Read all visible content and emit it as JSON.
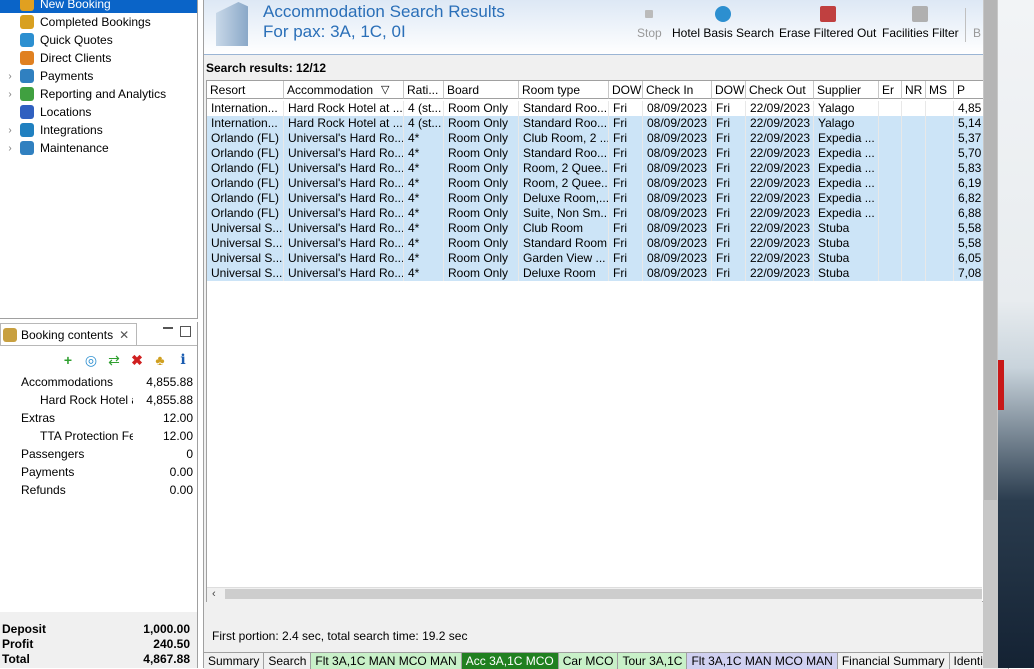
{
  "nav": {
    "items": [
      {
        "label": "New Booking",
        "selected": true,
        "expandable": false,
        "icon": "new-booking-icon",
        "color": "#e0a020"
      },
      {
        "label": "Completed Bookings",
        "selected": false,
        "expandable": false,
        "icon": "palm-icon",
        "color": "#d8a020"
      },
      {
        "label": "Quick Quotes",
        "selected": false,
        "expandable": false,
        "icon": "globe-icon",
        "color": "#2c8fd0"
      },
      {
        "label": "Direct Clients",
        "selected": false,
        "expandable": false,
        "icon": "user-icon",
        "color": "#e08020"
      },
      {
        "label": "Payments",
        "selected": false,
        "expandable": true,
        "icon": "payments-icon",
        "color": "#3080c0"
      },
      {
        "label": "Reporting and Analytics",
        "selected": false,
        "expandable": true,
        "icon": "analytics-icon",
        "color": "#40a040"
      },
      {
        "label": "Locations",
        "selected": false,
        "expandable": false,
        "icon": "locations-icon",
        "color": "#3060c0"
      },
      {
        "label": "Integrations",
        "selected": false,
        "expandable": true,
        "icon": "integrations-icon",
        "color": "#2080c0"
      },
      {
        "label": "Maintenance",
        "selected": false,
        "expandable": true,
        "icon": "maintenance-icon",
        "color": "#3080c0"
      }
    ]
  },
  "booking": {
    "tab_label": "Booking contents",
    "rows": [
      {
        "label": "Accommodations",
        "value": "4,855.88",
        "indent": 1
      },
      {
        "label": "Hard Rock Hotel at Universal",
        "value": "4,855.88",
        "indent": 2
      },
      {
        "label": "Extras",
        "value": "12.00",
        "indent": 1
      },
      {
        "label": "TTA Protection Fee",
        "value": "12.00",
        "indent": 2
      },
      {
        "label": "Passengers",
        "value": "0",
        "indent": 1
      },
      {
        "label": "Payments",
        "value": "0.00",
        "indent": 1
      },
      {
        "label": "Refunds",
        "value": "0.00",
        "indent": 1
      }
    ],
    "totals": [
      {
        "label": "Deposit",
        "value": "1,000.00"
      },
      {
        "label": "Profit",
        "value": "240.50"
      },
      {
        "label": "Total",
        "value": "4,867.88"
      }
    ]
  },
  "header": {
    "title": "Accommodation Search Results",
    "subtitle": "For pax: 3A, 1C, 0I",
    "toolbar": {
      "stop": "Stop",
      "hotel_basis_search": "Hotel Basis Search",
      "erase_filtered_out": "Erase Filtered Out",
      "facilities_filter": "Facilities Filter",
      "overflow": "B"
    }
  },
  "results": {
    "label": "Search results: 12/12",
    "columns": [
      "Resort",
      "Accommodation",
      "Rati...",
      "Board",
      "Room type",
      "DOW",
      "Check In",
      "DOW",
      "Check Out",
      "Supplier",
      "Er",
      "NR",
      "MS",
      "P"
    ],
    "rows": [
      [
        "Internation...",
        "Hard Rock Hotel at ...",
        "4 (st...",
        "Room Only",
        "Standard Roo...",
        "Fri",
        "08/09/2023",
        "Fri",
        "22/09/2023",
        "Yalago",
        "",
        "",
        "",
        "4,85"
      ],
      [
        "Internation...",
        "Hard Rock Hotel at ...",
        "4 (st...",
        "Room Only",
        "Standard Roo...",
        "Fri",
        "08/09/2023",
        "Fri",
        "22/09/2023",
        "Yalago",
        "",
        "",
        "",
        "5,14"
      ],
      [
        "Orlando (FL)",
        "Universal's Hard Ro...",
        "4*",
        "Room Only",
        "Club Room, 2 ...",
        "Fri",
        "08/09/2023",
        "Fri",
        "22/09/2023",
        "Expedia ...",
        "",
        "",
        "",
        "5,37"
      ],
      [
        "Orlando (FL)",
        "Universal's Hard Ro...",
        "4*",
        "Room Only",
        "Standard Roo...",
        "Fri",
        "08/09/2023",
        "Fri",
        "22/09/2023",
        "Expedia ...",
        "",
        "",
        "",
        "5,70"
      ],
      [
        "Orlando (FL)",
        "Universal's Hard Ro...",
        "4*",
        "Room Only",
        "Room, 2 Quee...",
        "Fri",
        "08/09/2023",
        "Fri",
        "22/09/2023",
        "Expedia ...",
        "",
        "",
        "",
        "5,83"
      ],
      [
        "Orlando (FL)",
        "Universal's Hard Ro...",
        "4*",
        "Room Only",
        "Room, 2 Quee...",
        "Fri",
        "08/09/2023",
        "Fri",
        "22/09/2023",
        "Expedia ...",
        "",
        "",
        "",
        "6,19"
      ],
      [
        "Orlando (FL)",
        "Universal's Hard Ro...",
        "4*",
        "Room Only",
        "Deluxe Room,...",
        "Fri",
        "08/09/2023",
        "Fri",
        "22/09/2023",
        "Expedia ...",
        "",
        "",
        "",
        "6,82"
      ],
      [
        "Orlando (FL)",
        "Universal's Hard Ro...",
        "4*",
        "Room Only",
        "Suite, Non Sm...",
        "Fri",
        "08/09/2023",
        "Fri",
        "22/09/2023",
        "Expedia ...",
        "",
        "",
        "",
        "6,88"
      ],
      [
        "Universal S...",
        "Universal's Hard Ro...",
        "4*",
        "Room Only",
        "Club Room",
        "Fri",
        "08/09/2023",
        "Fri",
        "22/09/2023",
        "Stuba",
        "",
        "",
        "",
        "5,58"
      ],
      [
        "Universal S...",
        "Universal's Hard Ro...",
        "4*",
        "Room Only",
        "Standard Room",
        "Fri",
        "08/09/2023",
        "Fri",
        "22/09/2023",
        "Stuba",
        "",
        "",
        "",
        "5,58"
      ],
      [
        "Universal S...",
        "Universal's Hard Ro...",
        "4*",
        "Room Only",
        "Garden View ...",
        "Fri",
        "08/09/2023",
        "Fri",
        "22/09/2023",
        "Stuba",
        "",
        "",
        "",
        "6,05"
      ],
      [
        "Universal S...",
        "Universal's Hard Ro...",
        "4*",
        "Room Only",
        "Deluxe Room",
        "Fri",
        "08/09/2023",
        "Fri",
        "22/09/2023",
        "Stuba",
        "",
        "",
        "",
        "7,08"
      ]
    ],
    "selected_row_color": "#cce4f7",
    "first_row_color": "#ffffff",
    "timing": "First portion: 2.4 sec, total search time: 19.2 sec"
  },
  "bottom_tabs": [
    {
      "label": "Summary",
      "color": "#f0f0f0",
      "text": "#000000"
    },
    {
      "label": "Search",
      "color": "#f0f0f0",
      "text": "#000000"
    },
    {
      "label": "Flt 3A,1C MAN MCO MAN",
      "color": "#c8f0c8",
      "text": "#000000"
    },
    {
      "label": "Acc 3A,1C MCO",
      "color": "#208020",
      "text": "#ffffff"
    },
    {
      "label": "Car MCO",
      "color": "#c8f0c8",
      "text": "#000000"
    },
    {
      "label": "Tour 3A,1C",
      "color": "#c8f0c8",
      "text": "#000000"
    },
    {
      "label": "Flt 3A,1C MAN MCO MAN",
      "color": "#d0d0f0",
      "text": "#000000"
    },
    {
      "label": "Financial Summary",
      "color": "#f0f0f0",
      "text": "#000000"
    },
    {
      "label": "Identity D",
      "color": "#f0f0f0",
      "text": "#000000"
    }
  ]
}
